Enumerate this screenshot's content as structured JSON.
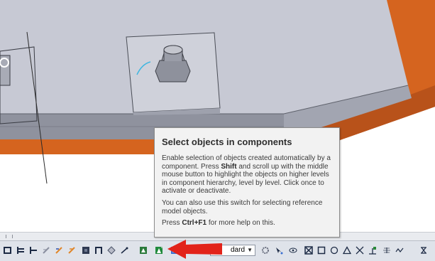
{
  "tooltip": {
    "title": "Select objects in components",
    "para1": [
      {
        "t": "Enable selection of objects created automatically by a component. Press "
      },
      {
        "t": "Shift",
        "b": true
      },
      {
        "t": " and scroll up with the middle mouse button to highlight the objects on higher levels in component hierarchy, level by level. Click once to activate or deactivate."
      }
    ],
    "para2": "You can also use this switch for selecting reference model objects.",
    "para3": [
      {
        "t": "Press "
      },
      {
        "t": "Ctrl+F1",
        "b": true
      },
      {
        "t": " for more help on this."
      }
    ]
  },
  "toolbar": {
    "filter_select_value": "dard",
    "dropdown_arrow": "▼"
  },
  "colors": {
    "slab_top": "#c7c9d4",
    "slab_side": "#8f929e",
    "orange_plate": "#d5641f",
    "tooltip_bg": "#f2f2f2",
    "toolbar_bg": "#dfe3ea",
    "arrow_red": "#e2231a"
  },
  "icons": [
    "select-assembly-icon",
    "select-object-icon",
    "select-part-icon",
    "select-bolt-icon",
    "select-weld-icon",
    "select-rebar-icon",
    "select-cut-icon",
    "select-component-icon",
    "select-surface-icon",
    "select-grid-icon",
    "select-point-icon",
    "select-objects-in-components-icon",
    "select-component-objects-icon",
    "snap-settings-icon",
    "snap-point-icon",
    "snap-reference-lines-icon",
    "snap-geometry-icon",
    "snap-circle-icon",
    "snap-triangle-icon",
    "snap-intersection-icon",
    "snap-perpendicular-icon",
    "snap-line-extension-icon",
    "snap-free-icon",
    "snap-x-icon"
  ]
}
